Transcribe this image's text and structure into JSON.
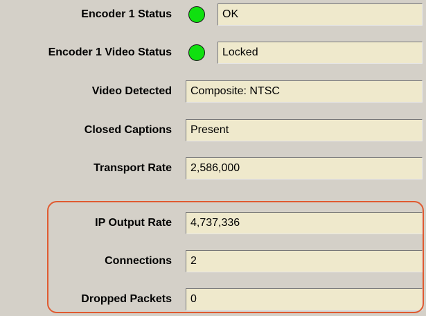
{
  "rows": [
    {
      "label": "Encoder 1 Status",
      "value": "OK",
      "indicator": "green-led"
    },
    {
      "label": "Encoder 1 Video Status",
      "value": "Locked",
      "indicator": "green-led"
    },
    {
      "label": "Video Detected",
      "value": "Composite: NTSC"
    },
    {
      "label": "Closed Captions",
      "value": "Present"
    },
    {
      "label": "Transport Rate",
      "value": "2,586,000"
    },
    {
      "label": "IP Output Rate",
      "value": "4,737,336"
    },
    {
      "label": "Connections",
      "value": "2"
    },
    {
      "label": "Dropped Packets",
      "value": "0"
    }
  ],
  "colors": {
    "background": "#d4d0c8",
    "field_background": "#efe9cc",
    "led_green": "#10e010",
    "highlight_border": "#e05a30"
  }
}
